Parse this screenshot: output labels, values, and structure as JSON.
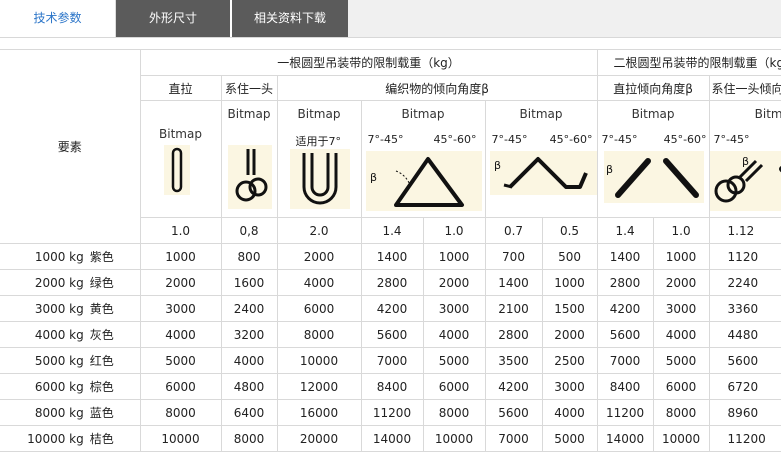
{
  "tabs": [
    {
      "label": "技术参数",
      "active": true
    },
    {
      "label": "外形尺寸",
      "active": false
    },
    {
      "label": "相关资料下载",
      "active": false
    }
  ],
  "table": {
    "element_label": "要素",
    "group1": "一根圆型吊装带的限制载重（kg）",
    "group2": "二根圆型吊装带的限制载重（kg",
    "sub": {
      "straight": "直拉",
      "choke": "系住一头",
      "angle": "编织物的倾向角度β",
      "straight_angle": "直拉倾向角度β",
      "choke2": "系住一头倾向"
    },
    "bitmap": "Bitmap",
    "pic_labels": {
      "u_shape": "适用于7°",
      "a1": "7°-45°",
      "a2": "45°-60°",
      "beta": "β"
    },
    "factors": [
      "1.0",
      "0,8",
      "2.0",
      "1.4",
      "1.0",
      "0.7",
      "0.5",
      "1.4",
      "1.0",
      "1.12"
    ],
    "rows": [
      {
        "kg": "1000 kg",
        "color": "紫色",
        "vals": [
          "1000",
          "800",
          "2000",
          "1400",
          "1000",
          "700",
          "500",
          "1400",
          "1000",
          "1120"
        ]
      },
      {
        "kg": "2000 kg",
        "color": "绿色",
        "vals": [
          "2000",
          "1600",
          "4000",
          "2800",
          "2000",
          "1400",
          "1000",
          "2800",
          "2000",
          "2240"
        ]
      },
      {
        "kg": "3000 kg",
        "color": "黄色",
        "vals": [
          "3000",
          "2400",
          "6000",
          "4200",
          "3000",
          "2100",
          "1500",
          "4200",
          "3000",
          "3360"
        ]
      },
      {
        "kg": "4000 kg",
        "color": "灰色",
        "vals": [
          "4000",
          "3200",
          "8000",
          "5600",
          "4000",
          "2800",
          "2000",
          "5600",
          "4000",
          "4480"
        ]
      },
      {
        "kg": "5000 kg",
        "color": "红色",
        "vals": [
          "5000",
          "4000",
          "10000",
          "7000",
          "5000",
          "3500",
          "2500",
          "7000",
          "5000",
          "5600"
        ]
      },
      {
        "kg": "6000 kg",
        "color": "棕色",
        "vals": [
          "6000",
          "4800",
          "12000",
          "8400",
          "6000",
          "4200",
          "3000",
          "8400",
          "6000",
          "6720"
        ]
      },
      {
        "kg": "8000 kg",
        "color": "蓝色",
        "vals": [
          "8000",
          "6400",
          "16000",
          "11200",
          "8000",
          "5600",
          "4000",
          "11200",
          "8000",
          "8960"
        ]
      },
      {
        "kg": "10000 kg",
        "color": "桔色",
        "vals": [
          "10000",
          "8000",
          "20000",
          "14000",
          "10000",
          "7000",
          "5000",
          "14000",
          "10000",
          "11200"
        ]
      }
    ]
  }
}
